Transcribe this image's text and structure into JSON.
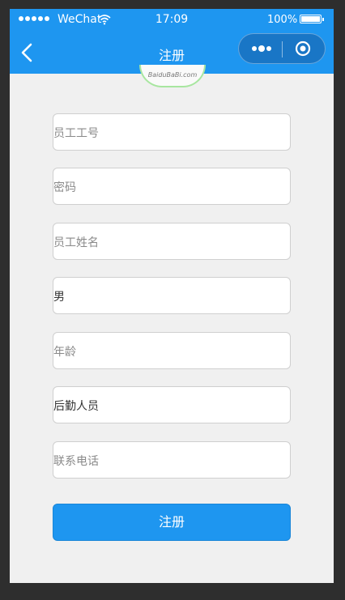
{
  "statusbar": {
    "carrier": "WeChat",
    "time": "17:09",
    "battery": "100%",
    "battery_level": 1.0
  },
  "navbar": {
    "title": "注册"
  },
  "logo": {
    "text": "BaiduBaBi.com"
  },
  "form": {
    "employee_id_placeholder": "员工工号",
    "password_placeholder": "密码",
    "name_placeholder": "员工姓名",
    "gender_value": "男",
    "age_placeholder": "年龄",
    "role_value": "后勤人员",
    "phone_placeholder": "联系电话",
    "submit_label": "注册"
  },
  "colors": {
    "accent": "#1e96f0",
    "background": "#f0f0f0"
  }
}
